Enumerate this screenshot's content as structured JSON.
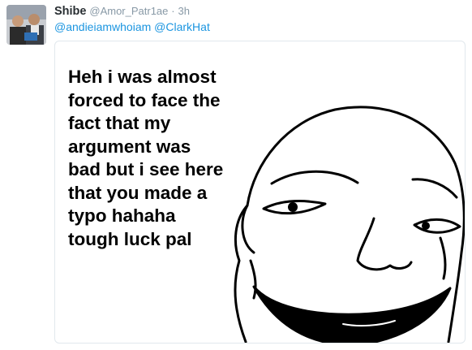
{
  "tweet": {
    "author": {
      "display_name": "Shibe",
      "handle": "@Amor_Patr1ae",
      "avatar_icon": "profile-photo"
    },
    "separator": "·",
    "timestamp": "3h",
    "mentions": [
      "@andieiamwhoiam",
      "@ClarkHat"
    ],
    "media": {
      "meme_text_lines": [
        "Heh i was almost",
        "forced to face the",
        "fact that my",
        "argument was",
        "bad but i see here",
        "that you made a",
        "typo hahaha",
        "tough luck pal"
      ],
      "drawing_icon": "smug-grinning-face-drawing"
    }
  },
  "colors": {
    "name": "#292f33",
    "secondary": "#8899a6",
    "link": "#1b95e0",
    "border": "#e1e8ed"
  }
}
